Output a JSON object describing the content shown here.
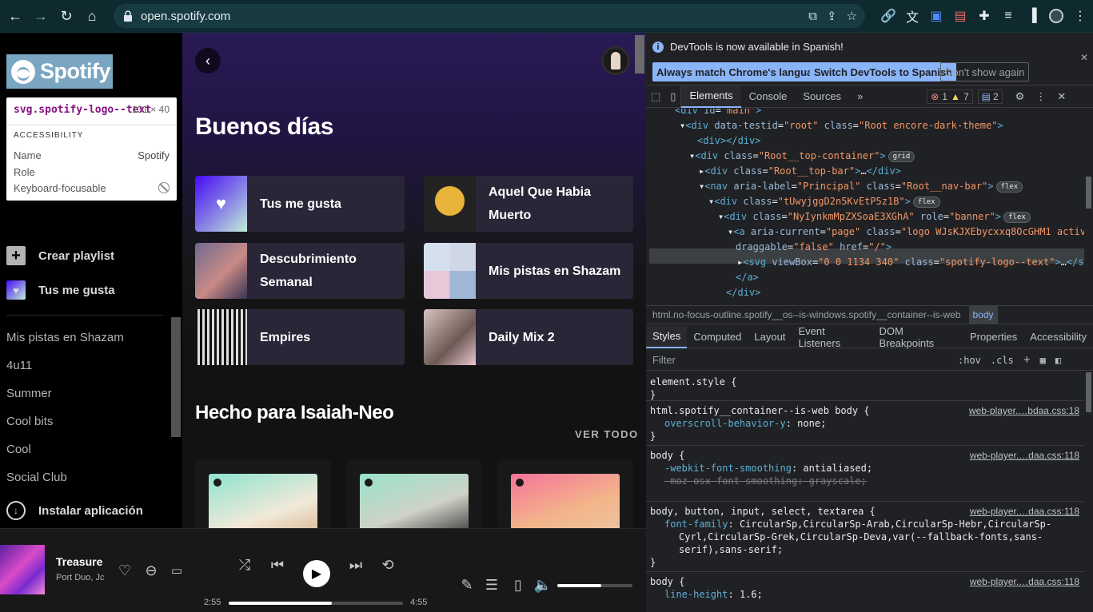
{
  "browser": {
    "url": "open.spotify.com"
  },
  "spotify": {
    "logo_text": "Spotify",
    "tooltip": {
      "selector": "svg.spotify-logo--text",
      "size": "131 × 40",
      "section": "ACCESSIBILITY",
      "rows": [
        {
          "label": "Name",
          "value": "Spotify"
        },
        {
          "label": "Role",
          "value": ""
        },
        {
          "label": "Keyboard-focusable",
          "value": ""
        }
      ]
    },
    "sidebar": {
      "create_playlist": "Crear playlist",
      "liked_songs": "Tus me gusta",
      "playlists": [
        "Mis pistas en Shazam",
        "4u11",
        "Summer",
        "Cool bits",
        "Cool",
        "Social Club"
      ],
      "install": "Instalar aplicación"
    },
    "main": {
      "greeting": "Buenos días",
      "cards": [
        {
          "title_lines": [
            "Tus me gusta"
          ]
        },
        {
          "title_lines": [
            "Aquel Que Habia",
            "Muerto"
          ]
        },
        {
          "title_lines": [
            "Descubrimiento",
            "Semanal"
          ]
        },
        {
          "title_lines": [
            "Mis pistas en Shazam"
          ]
        },
        {
          "title_lines": [
            "Empires"
          ]
        },
        {
          "title_lines": [
            "Daily Mix 2"
          ]
        }
      ],
      "section_title": "Hecho para Isaiah-Neo",
      "see_all": "VER TODO"
    },
    "player": {
      "track": "Treasure",
      "artist": "Port Duo, Jc",
      "elapsed": "2:55",
      "duration": "4:55",
      "progress": 0.59,
      "volume": 0.58
    }
  },
  "devtools": {
    "infobar": {
      "message": "DevTools is now available in Spanish!",
      "btn_match": "Always match Chrome's language",
      "btn_switch": "Switch DevTools to Spanish",
      "btn_dismiss": "Don't show again"
    },
    "tabs": [
      "Elements",
      "Console",
      "Sources"
    ],
    "errors": "1",
    "warnings": "7",
    "messages": "2",
    "breadcrumb": "html.no-focus-outline.spotify__os--is-windows.spotify__container--is-web",
    "breadcrumb_current": "body",
    "style_tabs": [
      "Styles",
      "Computed",
      "Layout",
      "Event Listeners",
      "DOM Breakpoints",
      "Properties",
      "Accessibility"
    ],
    "filter_placeholder": "Filter",
    "hov": ":hov",
    "cls": ".cls",
    "rules": [
      {
        "selector": "element.style {",
        "src": "",
        "props": []
      },
      {
        "selector": "html.spotify__container--is-web body {",
        "src": "web-player.…bdaa.css:18",
        "props": [
          {
            "name": "overscroll-behavior-y",
            "value": "none;"
          }
        ]
      },
      {
        "selector": "body {",
        "src": "web-player.…daa.css:118",
        "props": [
          {
            "name": "-webkit-font-smoothing",
            "value": "antialiased;"
          },
          {
            "name": "-moz-osx-font-smoothing",
            "value": "grayscale;"
          }
        ]
      },
      {
        "selector": "body, button, input, select, textarea {",
        "src": "web-player.…daa.css:118",
        "props": [
          {
            "name": "font-family",
            "value": "CircularSp,CircularSp-Arab,CircularSp-Hebr,CircularSp-"
          }
        ]
      },
      {
        "selector": "body {",
        "src": "web-player.…daa.css:118",
        "props": [
          {
            "name": "line-height",
            "value": "1.6;"
          }
        ]
      }
    ],
    "font_family_cont1": "Cyrl,CircularSp-Grek,CircularSp-Deva,var(--fallback-fonts,sans-",
    "font_family_cont2": "serif),sans-serif;"
  }
}
